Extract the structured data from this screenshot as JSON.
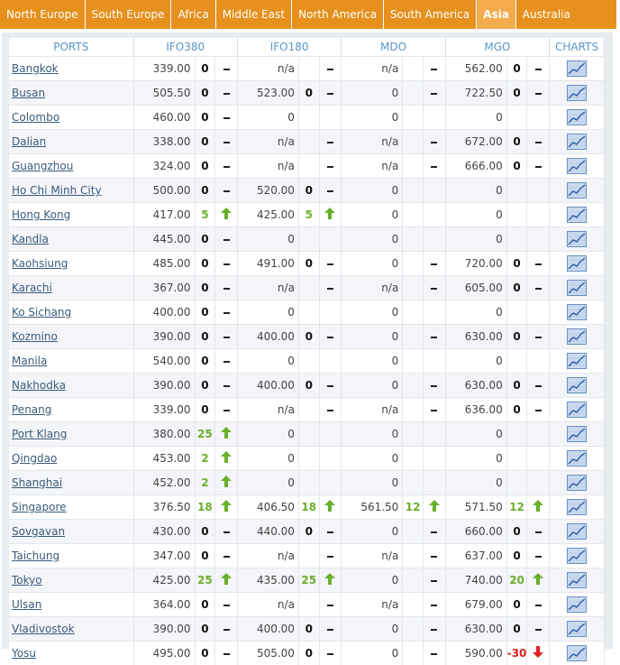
{
  "tabs": [
    {
      "label": "North Europe",
      "active": false
    },
    {
      "label": "South Europe",
      "active": false
    },
    {
      "label": "Africa",
      "active": false
    },
    {
      "label": "Middle East",
      "active": false
    },
    {
      "label": "North America",
      "active": false
    },
    {
      "label": "South America",
      "active": false
    },
    {
      "label": "Asia",
      "active": true
    },
    {
      "label": "Australia",
      "active": false
    }
  ],
  "headers": {
    "ports": "PORTS",
    "ifo380": "IFO380",
    "ifo180": "IFO180",
    "mdo": "MDO",
    "mgo": "MGO",
    "charts": "CHARTS"
  },
  "icons": {
    "dash": "dash-icon",
    "up": "arrow-up-icon",
    "down": "arrow-down-icon",
    "chart": "line-chart-icon"
  },
  "colors": {
    "tab_bar": "#e6911e",
    "tab_active": "#f3ab4c",
    "header_text": "#5b95c8",
    "up": "#6aaf2a",
    "down": "#e02020"
  },
  "rows": [
    {
      "port": "Bangkok",
      "ifo380": "339.00",
      "ifo380_chg": "0",
      "ifo380_dir": "flat",
      "ifo180": "n/a",
      "ifo180_chg": "",
      "ifo180_dir": "flat",
      "mdo": "n/a",
      "mdo_chg": "",
      "mdo_dir": "flat",
      "mgo": "562.00",
      "mgo_chg": "0",
      "mgo_dir": "flat"
    },
    {
      "port": "Busan",
      "ifo380": "505.50",
      "ifo380_chg": "0",
      "ifo380_dir": "flat",
      "ifo180": "523.00",
      "ifo180_chg": "0",
      "ifo180_dir": "flat",
      "mdo": "0",
      "mdo_chg": "",
      "mdo_dir": "flat",
      "mgo": "722.50",
      "mgo_chg": "0",
      "mgo_dir": "flat"
    },
    {
      "port": "Colombo",
      "ifo380": "460.00",
      "ifo380_chg": "0",
      "ifo380_dir": "flat",
      "ifo180": "0",
      "ifo180_chg": "",
      "ifo180_dir": "none",
      "mdo": "0",
      "mdo_chg": "",
      "mdo_dir": "none",
      "mgo": "0",
      "mgo_chg": "",
      "mgo_dir": "none"
    },
    {
      "port": "Dalian",
      "ifo380": "338.00",
      "ifo380_chg": "0",
      "ifo380_dir": "flat",
      "ifo180": "n/a",
      "ifo180_chg": "",
      "ifo180_dir": "flat",
      "mdo": "n/a",
      "mdo_chg": "",
      "mdo_dir": "flat",
      "mgo": "672.00",
      "mgo_chg": "0",
      "mgo_dir": "flat"
    },
    {
      "port": "Guangzhou",
      "ifo380": "324.00",
      "ifo380_chg": "0",
      "ifo380_dir": "flat",
      "ifo180": "n/a",
      "ifo180_chg": "",
      "ifo180_dir": "flat",
      "mdo": "n/a",
      "mdo_chg": "",
      "mdo_dir": "flat",
      "mgo": "666.00",
      "mgo_chg": "0",
      "mgo_dir": "flat"
    },
    {
      "port": "Ho Chi Minh City",
      "ifo380": "500.00",
      "ifo380_chg": "0",
      "ifo380_dir": "flat",
      "ifo180": "520.00",
      "ifo180_chg": "0",
      "ifo180_dir": "flat",
      "mdo": "0",
      "mdo_chg": "",
      "mdo_dir": "none",
      "mgo": "0",
      "mgo_chg": "",
      "mgo_dir": "none"
    },
    {
      "port": "Hong Kong",
      "ifo380": "417.00",
      "ifo380_chg": "5",
      "ifo380_dir": "up",
      "ifo180": "425.00",
      "ifo180_chg": "5",
      "ifo180_dir": "up",
      "mdo": "0",
      "mdo_chg": "",
      "mdo_dir": "none",
      "mgo": "0",
      "mgo_chg": "",
      "mgo_dir": "none"
    },
    {
      "port": "Kandla",
      "ifo380": "445.00",
      "ifo380_chg": "0",
      "ifo380_dir": "flat",
      "ifo180": "0",
      "ifo180_chg": "",
      "ifo180_dir": "none",
      "mdo": "0",
      "mdo_chg": "",
      "mdo_dir": "none",
      "mgo": "0",
      "mgo_chg": "",
      "mgo_dir": "none"
    },
    {
      "port": "Kaohsiung",
      "ifo380": "485.00",
      "ifo380_chg": "0",
      "ifo380_dir": "flat",
      "ifo180": "491.00",
      "ifo180_chg": "0",
      "ifo180_dir": "flat",
      "mdo": "0",
      "mdo_chg": "",
      "mdo_dir": "flat",
      "mgo": "720.00",
      "mgo_chg": "0",
      "mgo_dir": "flat"
    },
    {
      "port": "Karachi",
      "ifo380": "367.00",
      "ifo380_chg": "0",
      "ifo380_dir": "flat",
      "ifo180": "n/a",
      "ifo180_chg": "",
      "ifo180_dir": "flat",
      "mdo": "n/a",
      "mdo_chg": "",
      "mdo_dir": "flat",
      "mgo": "605.00",
      "mgo_chg": "0",
      "mgo_dir": "flat"
    },
    {
      "port": "Ko Sichang",
      "ifo380": "400.00",
      "ifo380_chg": "0",
      "ifo380_dir": "flat",
      "ifo180": "0",
      "ifo180_chg": "",
      "ifo180_dir": "none",
      "mdo": "0",
      "mdo_chg": "",
      "mdo_dir": "none",
      "mgo": "0",
      "mgo_chg": "",
      "mgo_dir": "none"
    },
    {
      "port": "Kozmino",
      "ifo380": "390.00",
      "ifo380_chg": "0",
      "ifo380_dir": "flat",
      "ifo180": "400.00",
      "ifo180_chg": "0",
      "ifo180_dir": "flat",
      "mdo": "0",
      "mdo_chg": "",
      "mdo_dir": "flat",
      "mgo": "630.00",
      "mgo_chg": "0",
      "mgo_dir": "flat"
    },
    {
      "port": "Manila",
      "ifo380": "540.00",
      "ifo380_chg": "0",
      "ifo380_dir": "flat",
      "ifo180": "0",
      "ifo180_chg": "",
      "ifo180_dir": "none",
      "mdo": "0",
      "mdo_chg": "",
      "mdo_dir": "none",
      "mgo": "0",
      "mgo_chg": "",
      "mgo_dir": "none"
    },
    {
      "port": "Nakhodka",
      "ifo380": "390.00",
      "ifo380_chg": "0",
      "ifo380_dir": "flat",
      "ifo180": "400.00",
      "ifo180_chg": "0",
      "ifo180_dir": "flat",
      "mdo": "0",
      "mdo_chg": "",
      "mdo_dir": "flat",
      "mgo": "630.00",
      "mgo_chg": "0",
      "mgo_dir": "flat"
    },
    {
      "port": "Penang",
      "ifo380": "339.00",
      "ifo380_chg": "0",
      "ifo380_dir": "flat",
      "ifo180": "n/a",
      "ifo180_chg": "",
      "ifo180_dir": "flat",
      "mdo": "n/a",
      "mdo_chg": "",
      "mdo_dir": "flat",
      "mgo": "636.00",
      "mgo_chg": "0",
      "mgo_dir": "flat"
    },
    {
      "port": "Port Klang",
      "ifo380": "380.00",
      "ifo380_chg": "25",
      "ifo380_dir": "up",
      "ifo180": "0",
      "ifo180_chg": "",
      "ifo180_dir": "none",
      "mdo": "0",
      "mdo_chg": "",
      "mdo_dir": "none",
      "mgo": "0",
      "mgo_chg": "",
      "mgo_dir": "none"
    },
    {
      "port": "Qingdao",
      "ifo380": "453.00",
      "ifo380_chg": "2",
      "ifo380_dir": "up",
      "ifo180": "0",
      "ifo180_chg": "",
      "ifo180_dir": "none",
      "mdo": "0",
      "mdo_chg": "",
      "mdo_dir": "none",
      "mgo": "0",
      "mgo_chg": "",
      "mgo_dir": "none"
    },
    {
      "port": "Shanghai",
      "ifo380": "452.00",
      "ifo380_chg": "2",
      "ifo380_dir": "up",
      "ifo180": "0",
      "ifo180_chg": "",
      "ifo180_dir": "none",
      "mdo": "0",
      "mdo_chg": "",
      "mdo_dir": "none",
      "mgo": "0",
      "mgo_chg": "",
      "mgo_dir": "none"
    },
    {
      "port": "Singapore",
      "ifo380": "376.50",
      "ifo380_chg": "18",
      "ifo380_dir": "up",
      "ifo180": "406.50",
      "ifo180_chg": "18",
      "ifo180_dir": "up",
      "mdo": "561.50",
      "mdo_chg": "12",
      "mdo_dir": "up",
      "mgo": "571.50",
      "mgo_chg": "12",
      "mgo_dir": "up"
    },
    {
      "port": "Sovgavan",
      "ifo380": "430.00",
      "ifo380_chg": "0",
      "ifo380_dir": "flat",
      "ifo180": "440.00",
      "ifo180_chg": "0",
      "ifo180_dir": "flat",
      "mdo": "0",
      "mdo_chg": "",
      "mdo_dir": "flat",
      "mgo": "660.00",
      "mgo_chg": "0",
      "mgo_dir": "flat"
    },
    {
      "port": "Taichung",
      "ifo380": "347.00",
      "ifo380_chg": "0",
      "ifo380_dir": "flat",
      "ifo180": "n/a",
      "ifo180_chg": "",
      "ifo180_dir": "flat",
      "mdo": "n/a",
      "mdo_chg": "",
      "mdo_dir": "flat",
      "mgo": "637.00",
      "mgo_chg": "0",
      "mgo_dir": "flat"
    },
    {
      "port": "Tokyo",
      "ifo380": "425.00",
      "ifo380_chg": "25",
      "ifo380_dir": "up",
      "ifo180": "435.00",
      "ifo180_chg": "25",
      "ifo180_dir": "up",
      "mdo": "0",
      "mdo_chg": "",
      "mdo_dir": "flat",
      "mgo": "740.00",
      "mgo_chg": "20",
      "mgo_dir": "up"
    },
    {
      "port": "Ulsan",
      "ifo380": "364.00",
      "ifo380_chg": "0",
      "ifo380_dir": "flat",
      "ifo180": "n/a",
      "ifo180_chg": "",
      "ifo180_dir": "flat",
      "mdo": "n/a",
      "mdo_chg": "",
      "mdo_dir": "flat",
      "mgo": "679.00",
      "mgo_chg": "0",
      "mgo_dir": "flat"
    },
    {
      "port": "Vladivostok",
      "ifo380": "390.00",
      "ifo380_chg": "0",
      "ifo380_dir": "flat",
      "ifo180": "400.00",
      "ifo180_chg": "0",
      "ifo180_dir": "flat",
      "mdo": "0",
      "mdo_chg": "",
      "mdo_dir": "flat",
      "mgo": "630.00",
      "mgo_chg": "0",
      "mgo_dir": "flat"
    },
    {
      "port": "Yosu",
      "ifo380": "495.00",
      "ifo380_chg": "0",
      "ifo380_dir": "flat",
      "ifo180": "505.00",
      "ifo180_chg": "0",
      "ifo180_dir": "flat",
      "mdo": "0",
      "mdo_chg": "",
      "mdo_dir": "flat",
      "mgo": "590.00",
      "mgo_chg": "-30",
      "mgo_dir": "down"
    }
  ]
}
